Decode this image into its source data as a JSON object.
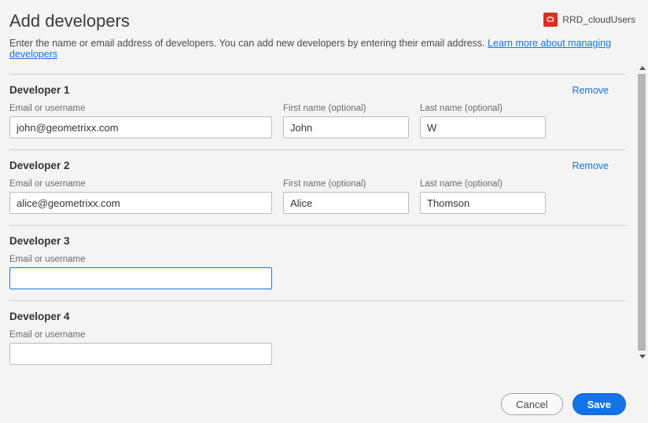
{
  "header": {
    "title": "Add developers",
    "subtitle_text": "Enter the name or email address of developers. You can add new developers by entering their email address. ",
    "learn_more": "Learn more about managing developers",
    "cloud_label": "RRD_cloudUsers"
  },
  "labels": {
    "email": "Email or username",
    "first_name": "First name (optional)",
    "last_name": "Last name (optional)",
    "remove": "Remove"
  },
  "developers": [
    {
      "heading": "Developer 1",
      "email": "john@geometrixx.com",
      "first_name": "John",
      "last_name": "W",
      "show_names": true,
      "removable": true,
      "focused": false
    },
    {
      "heading": "Developer 2",
      "email": "alice@geometrixx.com",
      "first_name": "Alice",
      "last_name": "Thomson",
      "show_names": true,
      "removable": true,
      "focused": false
    },
    {
      "heading": "Developer 3",
      "email": "",
      "first_name": "",
      "last_name": "",
      "show_names": false,
      "removable": false,
      "focused": true
    },
    {
      "heading": "Developer 4",
      "email": "",
      "first_name": "",
      "last_name": "",
      "show_names": false,
      "removable": false,
      "focused": false
    }
  ],
  "footer": {
    "cancel": "Cancel",
    "save": "Save"
  }
}
